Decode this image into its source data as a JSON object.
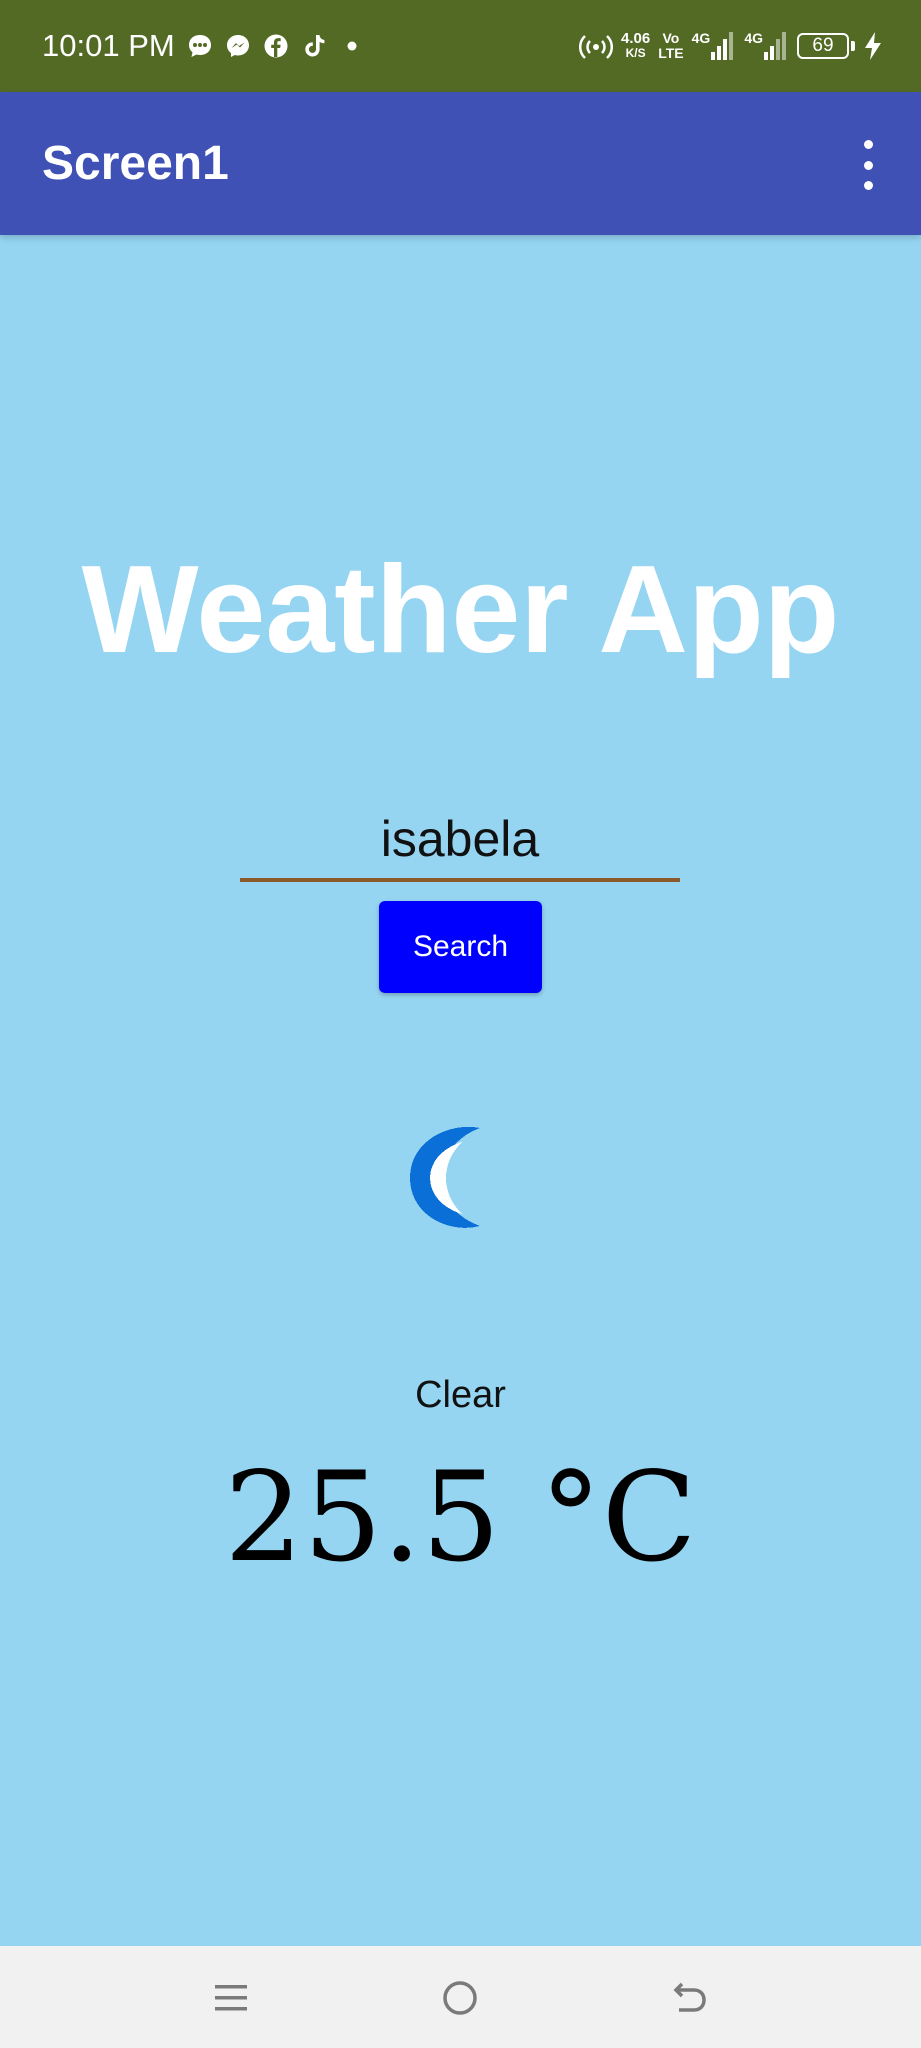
{
  "status_bar": {
    "time": "10:01 PM",
    "net_speed_value": "4.06",
    "net_speed_unit": "K/S",
    "volte_top": "Vo",
    "volte_bottom": "LTE",
    "sim1_label": "4G",
    "sim2_label": "4G",
    "battery_level": "69",
    "notification_icons": [
      "chat-bubble-icon",
      "messenger-icon",
      "facebook-icon",
      "tiktok-icon",
      "more-dot-icon"
    ],
    "system_icons": [
      "hotspot-icon",
      "signal-icon",
      "signal-icon",
      "battery-icon",
      "charging-bolt-icon"
    ]
  },
  "app_bar": {
    "title": "Screen1",
    "menu_icon": "overflow-menu-icon"
  },
  "main": {
    "heading": "Weather App",
    "city_input_value": "isabela",
    "search_label": "Search",
    "weather_icon": "crescent-moon-icon",
    "condition": "Clear",
    "temperature": "25.5 °C"
  },
  "nav_bar": {
    "icons": [
      "menu-icon",
      "home-icon",
      "back-icon"
    ]
  },
  "colors": {
    "status_bar_bg": "#536a25",
    "app_bar_bg": "#3f51b5",
    "screen_bg": "#95d5f2",
    "button_bg": "#0000ff",
    "input_underline": "#8b5a2b",
    "heading_text": "#ffffff",
    "moon_icon": "#0a6fd6"
  }
}
